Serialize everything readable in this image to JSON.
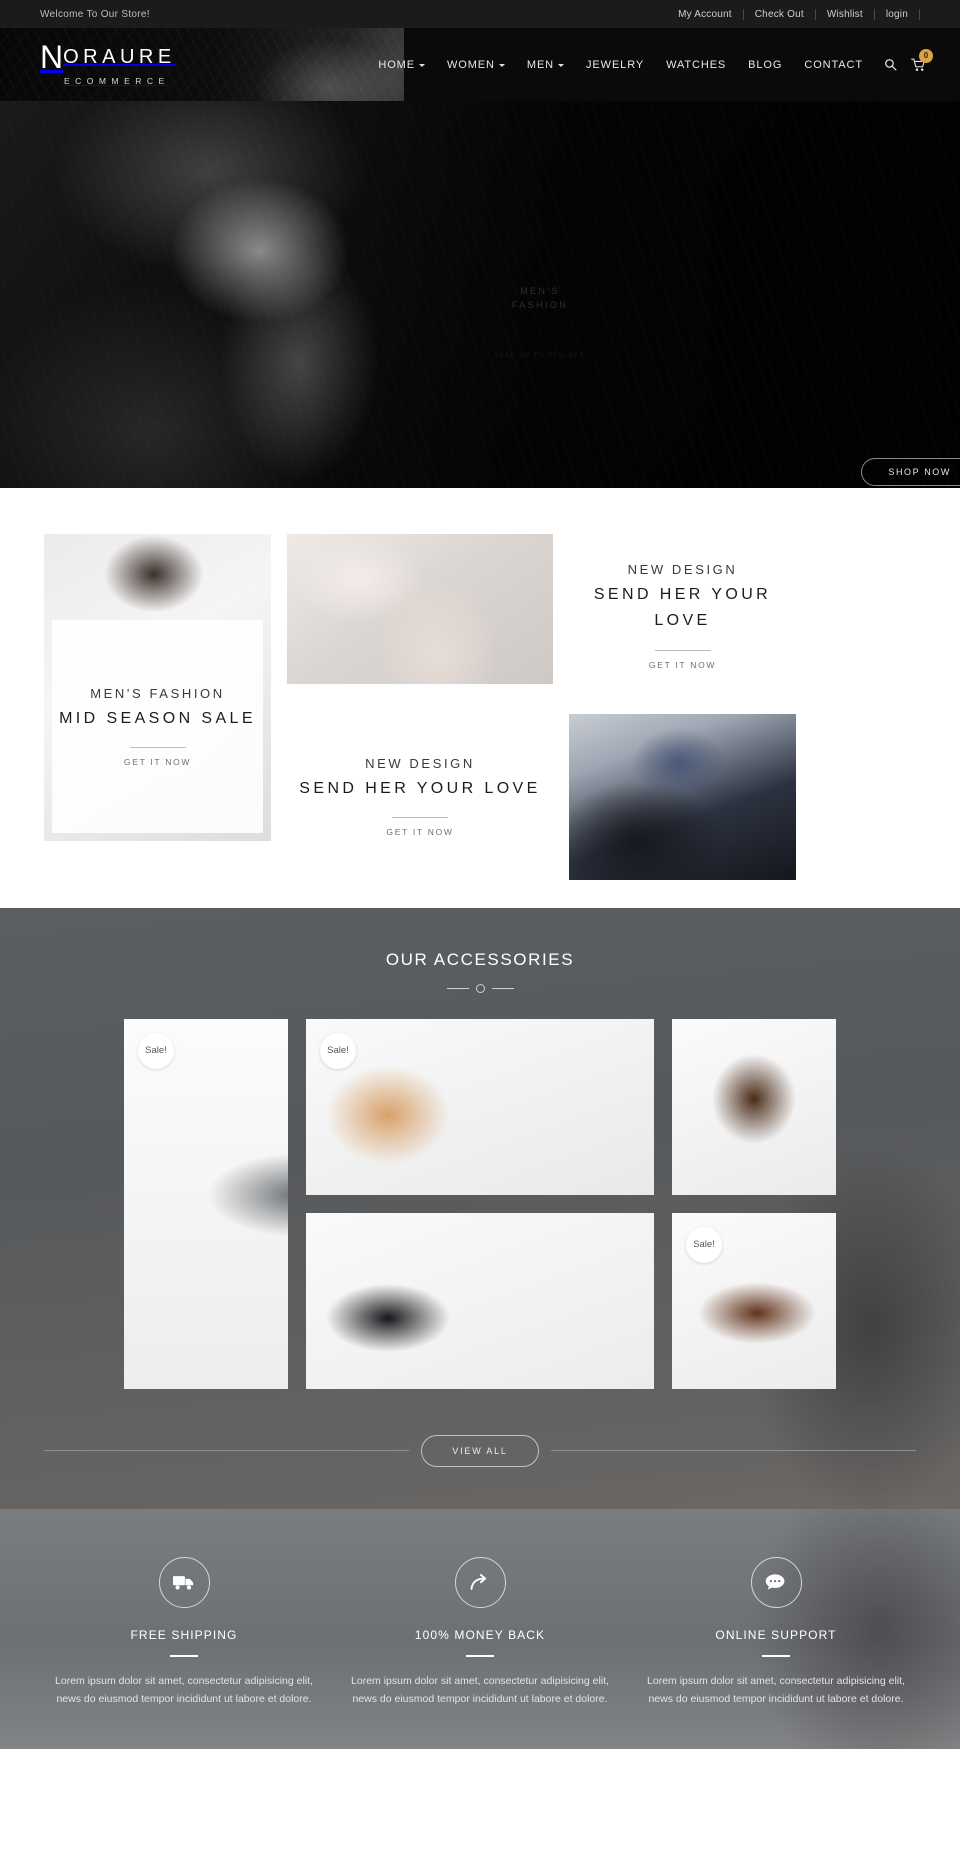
{
  "topbar": {
    "welcome": "Welcome To Our Store!",
    "links": [
      "My Account",
      "Check Out",
      "Wishlist",
      "login"
    ]
  },
  "header": {
    "logo_n": "N",
    "logo_rest": "ORAURE",
    "logo_sub": "ECOMMERCE",
    "nav": [
      {
        "label": "HOME",
        "caret": true
      },
      {
        "label": "WOMEN",
        "caret": true
      },
      {
        "label": "MEN",
        "caret": true
      },
      {
        "label": "JEWELRY",
        "caret": false
      },
      {
        "label": "WATCHES",
        "caret": false
      },
      {
        "label": "BLOG",
        "caret": false
      },
      {
        "label": "CONTACT",
        "caret": false
      }
    ],
    "search_icon": "search-icon",
    "cart_icon": "cart-icon",
    "cart_count": "0"
  },
  "hero": {
    "caption_line1": "MEN'S",
    "caption_line2": "FASHION",
    "subtext": "SALE UP TO 50% OFF",
    "shop_now": "SHOP NOW"
  },
  "promo": {
    "blocks": [
      {
        "eyebrow": "NEW DESIGN",
        "title": "SEND HER YOUR LOVE",
        "cta": "GET IT NOW"
      },
      {
        "eyebrow": "NEW DESIGN",
        "title": "SEND HER YOUR LOVE",
        "cta": "GET IT NOW"
      },
      {
        "eyebrow": "MEN'S FASHION",
        "title": "MID SEASON SALE",
        "cta": "GET IT NOW"
      }
    ]
  },
  "accessories": {
    "title": "OUR ACCESSORIES",
    "sale_label": "Sale!",
    "view_all": "VIEW ALL",
    "products": [
      {
        "name": "handbag",
        "sale": true
      },
      {
        "name": "sunglasses",
        "sale": true
      },
      {
        "name": "brown-boot",
        "sale": false
      },
      {
        "name": "black-dress-shoe",
        "sale": false
      },
      {
        "name": "brown-dress-shoe",
        "sale": true
      }
    ]
  },
  "features": [
    {
      "icon": "truck-icon",
      "title": "FREE SHIPPING",
      "text": "Lorem ipsum dolor sit amet, consectetur adipisicing elit, news do eiusmod tempor incididunt ut labore et dolore."
    },
    {
      "icon": "share-arrow-icon",
      "title": "100% MONEY BACK",
      "text": "Lorem ipsum dolor sit amet, consectetur adipisicing elit, news do eiusmod tempor incididunt ut labore et dolore."
    },
    {
      "icon": "chat-bubble-icon",
      "title": "ONLINE SUPPORT",
      "text": "Lorem ipsum dolor sit amet, consectetur adipisicing elit, news do eiusmod tempor incididunt ut labore et dolore."
    }
  ],
  "colors": {
    "topbar_bg": "#1b1b1b",
    "header_bg": "#0a0a0a",
    "accent_badge": "#d9a441",
    "accessories_bg": "#595d60",
    "features_bg": "#6e7275"
  }
}
